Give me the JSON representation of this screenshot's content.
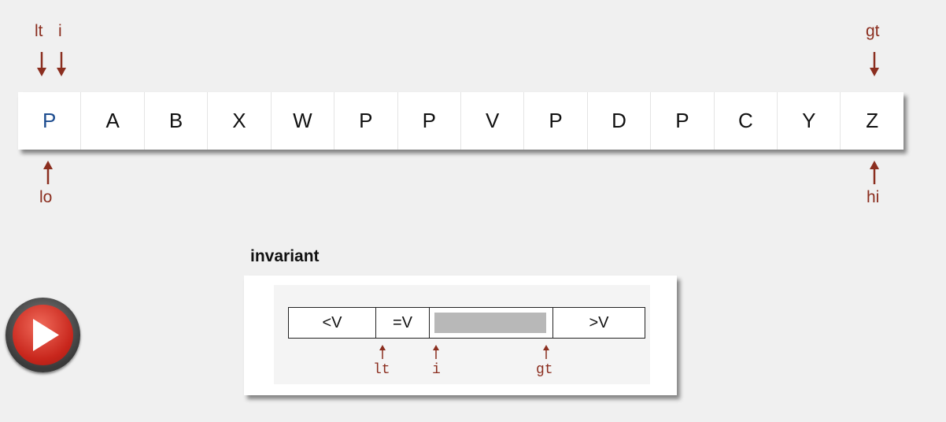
{
  "array": {
    "cells": [
      "P",
      "A",
      "B",
      "X",
      "W",
      "P",
      "P",
      "V",
      "P",
      "D",
      "P",
      "C",
      "Y",
      "Z"
    ],
    "highlight_index": 0,
    "highlight_color": "#1d4c8f"
  },
  "pointers": {
    "top": {
      "lt": "lt",
      "i": "i",
      "gt": "gt"
    },
    "bottom": {
      "lo": "lo",
      "hi": "hi"
    },
    "color": "#8b2e1f"
  },
  "invariant": {
    "title": "invariant",
    "segments": {
      "lt": "<V",
      "eq": "=V",
      "unknown": "",
      "gt": ">V"
    },
    "pointers": {
      "lt": "lt",
      "i": "i",
      "gt": "gt"
    }
  },
  "controls": {
    "play_icon": "play-icon"
  }
}
